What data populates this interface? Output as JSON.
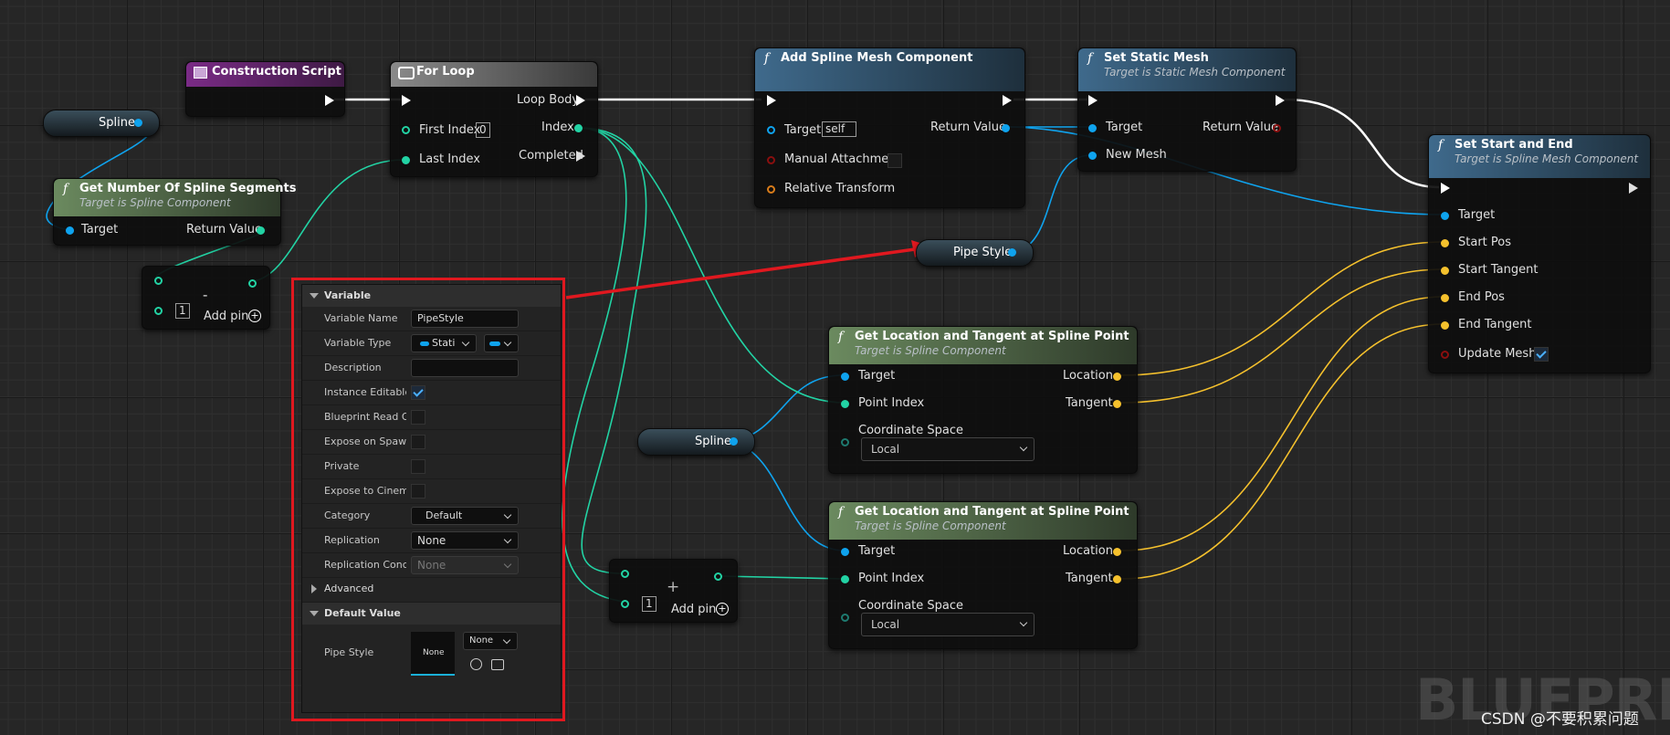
{
  "nodes": {
    "construction_script": {
      "title": "Construction Script"
    },
    "spline_var_top": {
      "label": "Spline"
    },
    "get_segments": {
      "title": "Get Number Of Spline Segments",
      "subtitle": "Target is Spline Component",
      "target": "Target",
      "return": "Return Value"
    },
    "subtract": {
      "symbol": "-",
      "pin_value": "1",
      "add_pin": "Add pin"
    },
    "for_loop": {
      "title": "For Loop",
      "loop_body": "Loop Body",
      "first_index": "First Index",
      "first_index_value": "0",
      "index": "Index",
      "last_index": "Last Index",
      "completed": "Completed"
    },
    "add_spline_mesh": {
      "title": "Add Spline Mesh Component",
      "target": "Target",
      "target_value": "self",
      "return": "Return Value",
      "manual_attachment": "Manual Attachment",
      "relative_transform": "Relative Transform"
    },
    "set_static_mesh": {
      "title": "Set Static Mesh",
      "subtitle": "Target is Static Mesh Component",
      "target": "Target",
      "return": "Return Value",
      "new_mesh": "New Mesh"
    },
    "set_start_end": {
      "title": "Set Start and End",
      "subtitle": "Target is Spline Mesh Component",
      "target": "Target",
      "start_pos": "Start Pos",
      "start_tangent": "Start Tangent",
      "end_pos": "End Pos",
      "end_tangent": "End Tangent",
      "update_mesh": "Update Mesh"
    },
    "pipe_style_var": {
      "label": "Pipe Style"
    },
    "get_loc_tan_1": {
      "title": "Get Location and Tangent at Spline Point",
      "subtitle": "Target is Spline Component",
      "target": "Target",
      "point_index": "Point Index",
      "coord_space": "Coordinate Space",
      "coord_value": "Local",
      "location": "Location",
      "tangent": "Tangent"
    },
    "get_loc_tan_2": {
      "title": "Get Location and Tangent at Spline Point",
      "subtitle": "Target is Spline Component",
      "target": "Target",
      "point_index": "Point Index",
      "coord_space": "Coordinate Space",
      "coord_value": "Local",
      "location": "Location",
      "tangent": "Tangent"
    },
    "spline_var_mid": {
      "label": "Spline"
    },
    "add_node": {
      "symbol": "+",
      "pin_value": "1",
      "add_pin": "Add pin"
    }
  },
  "panel": {
    "section_variable": "Variable",
    "variable_name_label": "Variable Name",
    "variable_name_value": "PipeStyle",
    "variable_type_label": "Variable Type",
    "variable_type_value": "Stati",
    "description_label": "Description",
    "instance_editable_label": "Instance Editable",
    "blueprint_read_label": "Blueprint Read O",
    "expose_spawn_label": "Expose on Spaw",
    "private_label": "Private",
    "expose_cinematics_label": "Expose to Cinem",
    "category_label": "Category",
    "category_value": "Default",
    "replication_label": "Replication",
    "replication_value": "None",
    "replication_cond_label": "Replication Conc",
    "replication_cond_value": "None",
    "section_advanced": "Advanced",
    "section_default": "Default Value",
    "pipe_style_label": "Pipe Style",
    "pipe_style_thumb": "None",
    "pipe_style_dropdown": "None"
  },
  "watermark": "BLUEPRINT",
  "credit": "CSDN @不要积累问题",
  "colors": {
    "exec": "#ffffff",
    "object": "#0fa3ee",
    "integer": "#22d3a4",
    "vector": "#f5c12d",
    "highlight": "#e0181f"
  }
}
